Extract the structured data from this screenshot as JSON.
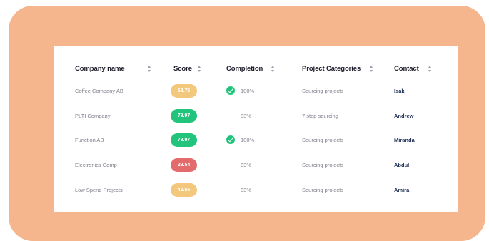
{
  "table": {
    "columns": [
      {
        "label": "Company name"
      },
      {
        "label": "Score"
      },
      {
        "label": "Completion"
      },
      {
        "label": "Project Categories"
      },
      {
        "label": "Contact"
      }
    ],
    "rows": [
      {
        "company": "Coffee Company AB",
        "score": "58.75",
        "score_status": "medium",
        "completion": "100%",
        "completed": true,
        "category": "Sourcing projects",
        "contact": "Isak"
      },
      {
        "company": "PLTI Company",
        "score": "78.97",
        "score_status": "high",
        "completion": "83%",
        "completed": false,
        "category": "7 step sourcing",
        "contact": "Andrew"
      },
      {
        "company": "Function AB",
        "score": "78.97",
        "score_status": "high",
        "completion": "100%",
        "completed": true,
        "category": "Sourcing projects",
        "contact": "Miranda"
      },
      {
        "company": "Electronics Comp",
        "score": "29.54",
        "score_status": "low",
        "completion": "83%",
        "completed": false,
        "category": "Sourcing projects",
        "contact": "Abdul"
      },
      {
        "company": "Low Spend Projects",
        "score": "42.55",
        "score_status": "medium",
        "completion": "83%",
        "completed": false,
        "category": "Sourcing projects",
        "contact": "Amira"
      }
    ]
  },
  "colors": {
    "frame": "#f6b68d",
    "score_high": "#22c47b",
    "score_medium": "#f3c87d",
    "score_low": "#e46b6b",
    "check": "#21c37a",
    "contact_text": "#1f2f55"
  },
  "icons": {
    "sort": "sort-icon",
    "complete": "check-circle-icon"
  }
}
